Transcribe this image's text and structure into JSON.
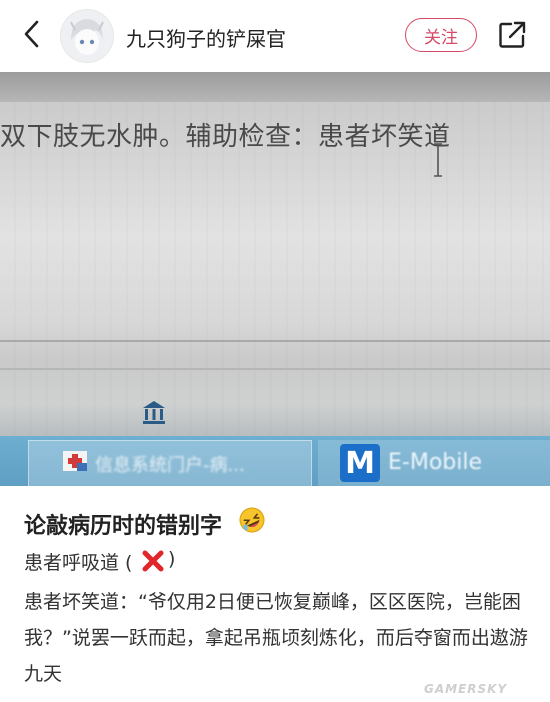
{
  "header": {
    "username": "九只狗子的铲屎官",
    "follow_label": "关注"
  },
  "photo": {
    "document_text": "双下肢无水肿。辅助检查：患者坏笑道",
    "taskbar_item1": "信息系统门户-病...",
    "taskbar_item2_badge": "M",
    "taskbar_item2": "E-Mobile",
    "taskbar_color": "#6eaed0"
  },
  "post": {
    "title": "论敲病历时的错别字",
    "line1_text": "患者呼吸道 (",
    "line1_end": ")",
    "line2": "患者坏笑道：“爷仅用2日便已恢复巅峰，区区医院，岂能困我？”说罢一跃而起，拿起吊瓶顷刻炼化，而后夺窗而出遨游九天"
  },
  "watermark": "GAMERSKY",
  "colors": {
    "accent": "#d54a67",
    "x_mark": "#e0262a"
  }
}
